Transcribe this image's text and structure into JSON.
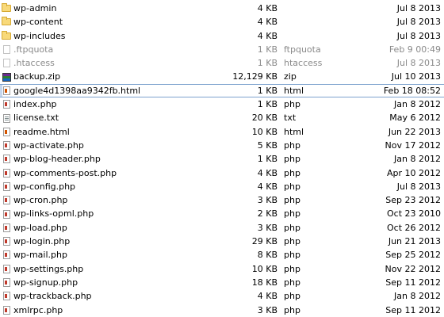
{
  "files": [
    {
      "name": "wp-admin",
      "size": "4 KB",
      "type": "",
      "date": "Jul 8 2013",
      "icon": "folder-icon",
      "dim": false,
      "selected": false
    },
    {
      "name": "wp-content",
      "size": "4 KB",
      "type": "",
      "date": "Jul 8 2013",
      "icon": "folder-icon",
      "dim": false,
      "selected": false
    },
    {
      "name": "wp-includes",
      "size": "4 KB",
      "type": "",
      "date": "Jul 8 2013",
      "icon": "folder-icon",
      "dim": false,
      "selected": false
    },
    {
      "name": ".ftpquota",
      "size": "1 KB",
      "type": "ftpquota",
      "date": "Feb 9 00:49",
      "icon": "document-icon",
      "dim": true,
      "selected": false
    },
    {
      "name": ".htaccess",
      "size": "1 KB",
      "type": "htaccess",
      "date": "Jul 8 2013",
      "icon": "document-icon",
      "dim": true,
      "selected": false
    },
    {
      "name": "backup.zip",
      "size": "12,129 KB",
      "type": "zip",
      "date": "Jul 10 2013",
      "icon": "zip-archive-icon",
      "dim": false,
      "selected": false
    },
    {
      "name": "google4d1398aa9342fb.html",
      "size": "1 KB",
      "type": "html",
      "date": "Feb 18 08:52",
      "icon": "html-file-icon",
      "dim": false,
      "selected": true
    },
    {
      "name": "index.php",
      "size": "1 KB",
      "type": "php",
      "date": "Jan 8 2012",
      "icon": "php-file-icon",
      "dim": false,
      "selected": false
    },
    {
      "name": "license.txt",
      "size": "20 KB",
      "type": "txt",
      "date": "May 6 2012",
      "icon": "text-file-icon",
      "dim": false,
      "selected": false
    },
    {
      "name": "readme.html",
      "size": "10 KB",
      "type": "html",
      "date": "Jun 22 2013",
      "icon": "html-file-icon",
      "dim": false,
      "selected": false
    },
    {
      "name": "wp-activate.php",
      "size": "5 KB",
      "type": "php",
      "date": "Nov 17 2012",
      "icon": "php-file-icon",
      "dim": false,
      "selected": false
    },
    {
      "name": "wp-blog-header.php",
      "size": "1 KB",
      "type": "php",
      "date": "Jan 8 2012",
      "icon": "php-file-icon",
      "dim": false,
      "selected": false
    },
    {
      "name": "wp-comments-post.php",
      "size": "4 KB",
      "type": "php",
      "date": "Apr 10 2012",
      "icon": "php-file-icon",
      "dim": false,
      "selected": false
    },
    {
      "name": "wp-config.php",
      "size": "4 KB",
      "type": "php",
      "date": "Jul 8 2013",
      "icon": "php-file-icon",
      "dim": false,
      "selected": false
    },
    {
      "name": "wp-cron.php",
      "size": "3 KB",
      "type": "php",
      "date": "Sep 23 2012",
      "icon": "php-file-icon",
      "dim": false,
      "selected": false
    },
    {
      "name": "wp-links-opml.php",
      "size": "2 KB",
      "type": "php",
      "date": "Oct 23 2010",
      "icon": "php-file-icon",
      "dim": false,
      "selected": false
    },
    {
      "name": "wp-load.php",
      "size": "3 KB",
      "type": "php",
      "date": "Oct 26 2012",
      "icon": "php-file-icon",
      "dim": false,
      "selected": false
    },
    {
      "name": "wp-login.php",
      "size": "29 KB",
      "type": "php",
      "date": "Jun 21 2013",
      "icon": "php-file-icon",
      "dim": false,
      "selected": false
    },
    {
      "name": "wp-mail.php",
      "size": "8 KB",
      "type": "php",
      "date": "Sep 25 2012",
      "icon": "php-file-icon",
      "dim": false,
      "selected": false
    },
    {
      "name": "wp-settings.php",
      "size": "10 KB",
      "type": "php",
      "date": "Nov 22 2012",
      "icon": "php-file-icon",
      "dim": false,
      "selected": false
    },
    {
      "name": "wp-signup.php",
      "size": "18 KB",
      "type": "php",
      "date": "Sep 11 2012",
      "icon": "php-file-icon",
      "dim": false,
      "selected": false
    },
    {
      "name": "wp-trackback.php",
      "size": "4 KB",
      "type": "php",
      "date": "Jan 8 2012",
      "icon": "php-file-icon",
      "dim": false,
      "selected": false
    },
    {
      "name": "xmlrpc.php",
      "size": "3 KB",
      "type": "php",
      "date": "Sep 11 2012",
      "icon": "php-file-icon",
      "dim": false,
      "selected": false
    }
  ],
  "colors": {
    "selection_border": "#7da2ce",
    "dim_text": "#8a8a8a"
  }
}
